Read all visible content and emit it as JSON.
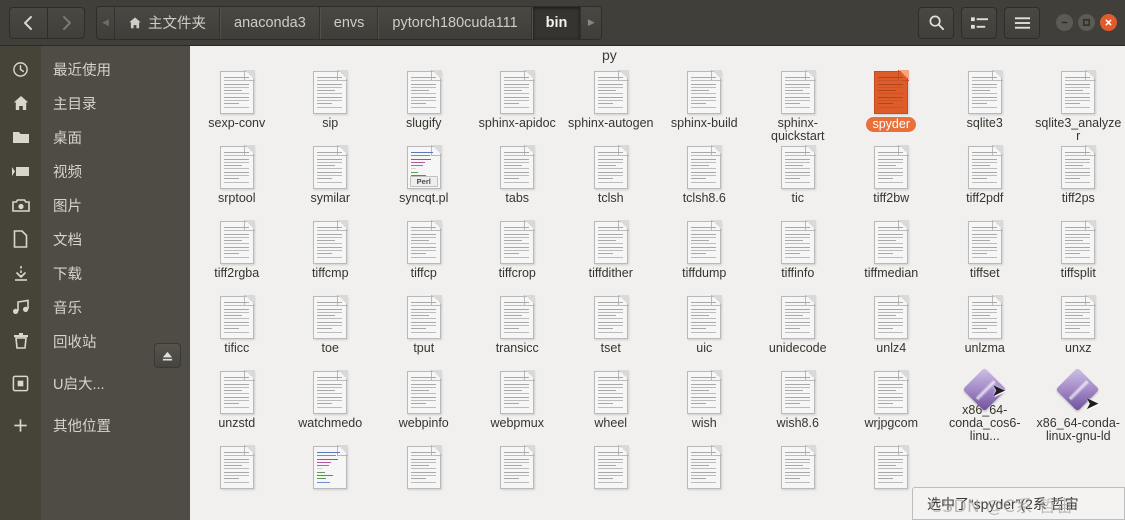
{
  "toolbar": {
    "back_icon": "chevron-left-icon",
    "forward_icon": "chevron-right-icon",
    "prev_crumb_icon": "chevron-left-small-icon",
    "next_crumb_icon": "chevron-right-small-icon",
    "breadcrumbs": [
      {
        "label": "主文件夹",
        "icon": "home-icon",
        "active": false
      },
      {
        "label": "anaconda3",
        "active": false
      },
      {
        "label": "envs",
        "active": false
      },
      {
        "label": "pytorch180cuda111",
        "active": false
      },
      {
        "label": "bin",
        "active": true
      }
    ],
    "search_label": "搜索",
    "search_icon": "search-icon",
    "view_toggle_icon": "list-view-icon",
    "menu_icon": "hamburger-menu-icon",
    "window_minimize_icon": "minimize-icon",
    "window_maximize_icon": "maximize-icon",
    "window_close_icon": "close-icon",
    "accent_color": "#e35a2b"
  },
  "sidebar": {
    "items": [
      {
        "label": "最近使用",
        "icon": "clock-icon"
      },
      {
        "label": "主目录",
        "icon": "home-icon"
      },
      {
        "label": "桌面",
        "icon": "folder-icon"
      },
      {
        "label": "视频",
        "icon": "video-icon"
      },
      {
        "label": "图片",
        "icon": "camera-icon"
      },
      {
        "label": "文档",
        "icon": "document-icon"
      },
      {
        "label": "下载",
        "icon": "download-icon"
      },
      {
        "label": "音乐",
        "icon": "music-note-icon"
      },
      {
        "label": "回收站",
        "icon": "trash-icon"
      },
      {
        "label": "U启大...",
        "icon": "drive-icon",
        "eject": true,
        "eject_icon": "eject-icon"
      },
      {
        "label": "其他位置",
        "icon": "plus-icon"
      }
    ],
    "bg_color": "#4e4c44"
  },
  "files": {
    "partial_top_label": "py",
    "selected": "spyder",
    "items": [
      {
        "name": "sexp-conv",
        "type": "document"
      },
      {
        "name": "sip",
        "type": "document"
      },
      {
        "name": "slugify",
        "type": "document"
      },
      {
        "name": "sphinx-apidoc",
        "type": "document"
      },
      {
        "name": "sphinx-autogen",
        "type": "document"
      },
      {
        "name": "sphinx-build",
        "type": "document"
      },
      {
        "name": "sphinx-quickstart",
        "type": "document"
      },
      {
        "name": "spyder",
        "type": "document",
        "selected": true
      },
      {
        "name": "sqlite3",
        "type": "document"
      },
      {
        "name": "sqlite3_analyzer",
        "type": "document"
      },
      {
        "name": "srptool",
        "type": "document"
      },
      {
        "name": "symilar",
        "type": "document"
      },
      {
        "name": "syncqt.pl",
        "type": "code",
        "badge": "Perl"
      },
      {
        "name": "tabs",
        "type": "document"
      },
      {
        "name": "tclsh",
        "type": "document"
      },
      {
        "name": "tclsh8.6",
        "type": "document"
      },
      {
        "name": "tic",
        "type": "document"
      },
      {
        "name": "tiff2bw",
        "type": "document"
      },
      {
        "name": "tiff2pdf",
        "type": "document"
      },
      {
        "name": "tiff2ps",
        "type": "document"
      },
      {
        "name": "tiff2rgba",
        "type": "document"
      },
      {
        "name": "tiffcmp",
        "type": "document"
      },
      {
        "name": "tiffcp",
        "type": "document"
      },
      {
        "name": "tiffcrop",
        "type": "document"
      },
      {
        "name": "tiffdither",
        "type": "document"
      },
      {
        "name": "tiffdump",
        "type": "document"
      },
      {
        "name": "tiffinfo",
        "type": "document"
      },
      {
        "name": "tiffmedian",
        "type": "document"
      },
      {
        "name": "tiffset",
        "type": "document"
      },
      {
        "name": "tiffsplit",
        "type": "document"
      },
      {
        "name": "tificc",
        "type": "document"
      },
      {
        "name": "toe",
        "type": "document"
      },
      {
        "name": "tput",
        "type": "document"
      },
      {
        "name": "transicc",
        "type": "document"
      },
      {
        "name": "tset",
        "type": "document"
      },
      {
        "name": "uic",
        "type": "document"
      },
      {
        "name": "unidecode",
        "type": "document"
      },
      {
        "name": "unlz4",
        "type": "document"
      },
      {
        "name": "unlzma",
        "type": "document"
      },
      {
        "name": "unxz",
        "type": "document"
      },
      {
        "name": "unzstd",
        "type": "document"
      },
      {
        "name": "watchmedo",
        "type": "document"
      },
      {
        "name": "webpinfo",
        "type": "document"
      },
      {
        "name": "webpmux",
        "type": "document"
      },
      {
        "name": "wheel",
        "type": "document"
      },
      {
        "name": "wish",
        "type": "document"
      },
      {
        "name": "wish8.6",
        "type": "document"
      },
      {
        "name": "wrjpgcom",
        "type": "document"
      },
      {
        "name": "x86_64-conda_cos6-linu...",
        "type": "binary-link"
      },
      {
        "name": "x86_64-conda-linux-gnu-ld",
        "type": "binary-link"
      },
      {
        "name": "",
        "type": "document"
      },
      {
        "name": "",
        "type": "code"
      },
      {
        "name": "",
        "type": "document"
      },
      {
        "name": "",
        "type": "document"
      },
      {
        "name": "",
        "type": "document"
      },
      {
        "name": "",
        "type": "document"
      },
      {
        "name": "",
        "type": "document"
      },
      {
        "name": "",
        "type": "document"
      }
    ]
  },
  "status": {
    "text": "选中了“spyder”(2系 哲宙",
    "watermark": "CSDN @C系 哲宙"
  }
}
